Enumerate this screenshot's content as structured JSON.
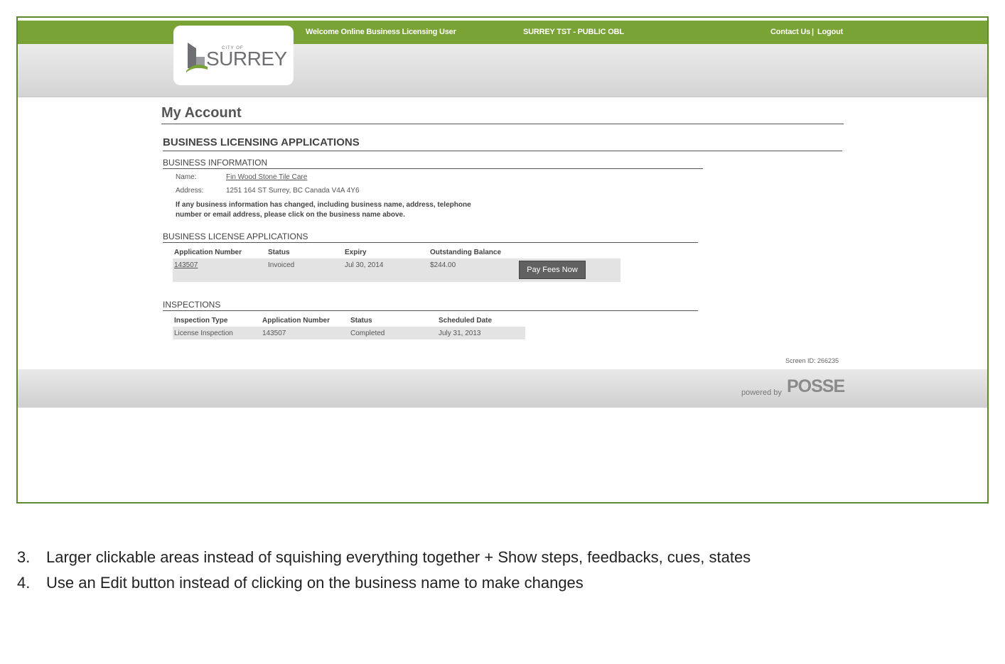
{
  "header": {
    "welcome": "Welcome Online Business Licensing User",
    "environment": "SURREY TST - PUBLIC OBL",
    "contact_label": "Contact Us",
    "separator": "|",
    "logout_label": "Logout"
  },
  "logo": {
    "city_of": "CITY OF",
    "name": "SURREY"
  },
  "page_title": "My Account",
  "section_title": "BUSINESS LICENSING APPLICATIONS",
  "business_info": {
    "heading": "BUSINESS INFORMATION",
    "name_label": "Name:",
    "name_value": "Fin Wood Stone Tile Care",
    "address_label": "Address:",
    "address_value": "1251 164 ST Surrey, BC Canada V4A 4Y6",
    "notice_line1": "If any business information has changed, including business name, address, telephone",
    "notice_line2": "number or email address, please click on the business name above."
  },
  "applications": {
    "heading": "BUSINESS LICENSE APPLICATIONS",
    "columns": [
      "Application Number",
      "Status",
      "Expiry",
      "Outstanding Balance"
    ],
    "rows": [
      {
        "number": "143507",
        "status": "Invoiced",
        "expiry": "Jul 30, 2014",
        "balance": "$244.00"
      }
    ],
    "pay_button": "Pay Fees Now"
  },
  "inspections": {
    "heading": "INSPECTIONS",
    "columns": [
      "Inspection Type",
      "Application Number",
      "Status",
      "Scheduled Date"
    ],
    "rows": [
      {
        "type": "License Inspection",
        "number": "143507",
        "status": "Completed",
        "date": "July 31, 2013"
      }
    ]
  },
  "screen_id": "Screen ID: 266235",
  "footer": {
    "powered_by": "powered by",
    "brand": "POSSE"
  },
  "notes": [
    {
      "num": "3.",
      "text": "Larger clickable areas instead of squishing everything together + Show steps, feedbacks, cues, states"
    },
    {
      "num": "4.",
      "text": "Use an Edit button instead of clicking on the business name to make changes"
    }
  ],
  "colors": {
    "brand_green": "#7aa336",
    "frame_border": "#5d8a2e",
    "button": "#616161"
  }
}
